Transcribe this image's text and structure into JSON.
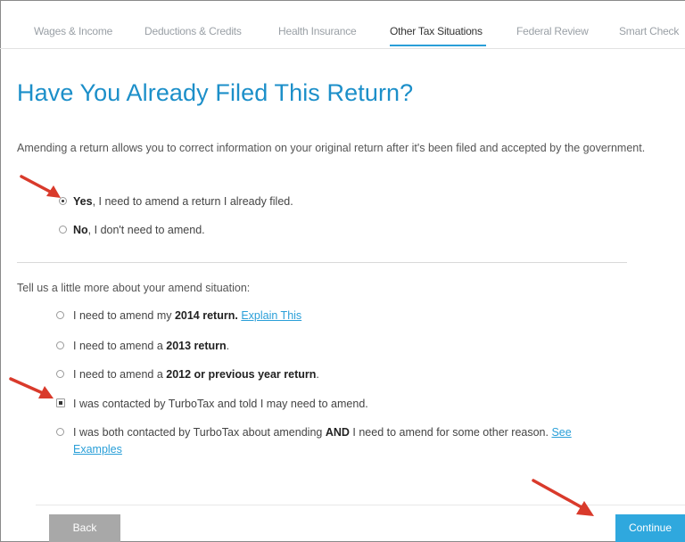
{
  "tabs": [
    {
      "label": "Wages & Income",
      "active": false
    },
    {
      "label": "Deductions & Credits",
      "active": false
    },
    {
      "label": "Health Insurance",
      "active": false
    },
    {
      "label": "Other Tax Situations",
      "active": true
    },
    {
      "label": "Federal Review",
      "active": false
    },
    {
      "label": "Smart Check",
      "active": false
    }
  ],
  "page_title": "Have You Already Filed This Return?",
  "intro_text": "Amending a return allows you to correct information on your original return after it's been filed and accepted by the government.",
  "filed_options": [
    {
      "bold": "Yes",
      "rest": ", I need to amend a return I already filed.",
      "selected": true
    },
    {
      "bold": "No",
      "rest": ", I don't need to amend.",
      "selected": false
    }
  ],
  "amend_prompt": "Tell us a little more about your amend situation:",
  "amend_options": [
    {
      "pre": "I need to amend my ",
      "bold": "2014 return.",
      "post": " ",
      "link": "Explain This",
      "selected": false
    },
    {
      "pre": "I need to amend a ",
      "bold": "2013 return",
      "post": ".",
      "link": "",
      "selected": false
    },
    {
      "pre": "I need to amend a ",
      "bold": "2012 or previous year return",
      "post": ".",
      "link": "",
      "selected": false
    },
    {
      "pre": "I was contacted by TurboTax and told I may need to amend.",
      "bold": "",
      "post": "",
      "link": "",
      "selected": true
    },
    {
      "pre": "I was both contacted by TurboTax about amending ",
      "bold": "AND",
      "post": " I need to amend for some other reason. ",
      "link_line1": "See",
      "link_line2": "Examples",
      "selected": false
    }
  ],
  "buttons": {
    "back": "Back",
    "continue": "Continue"
  },
  "colors": {
    "accent": "#2a9fd8",
    "title": "#1c8fc9",
    "annotation_arrow": "#d93a2b"
  }
}
